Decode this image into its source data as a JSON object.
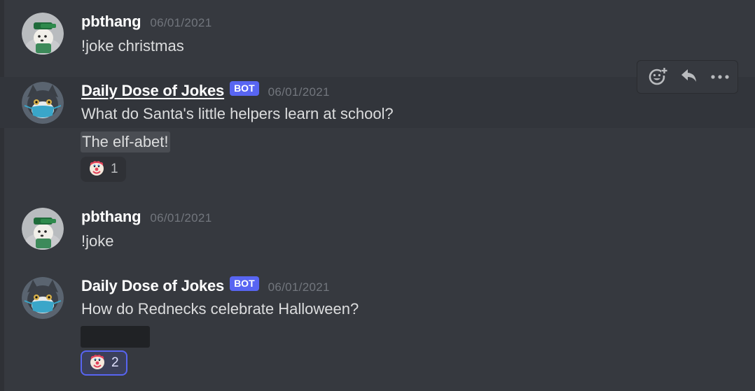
{
  "messages": [
    {
      "author": "pbthang",
      "timestamp": "06/01/2021",
      "content": "!joke christmas",
      "avatar": "dog-avatar"
    },
    {
      "author": "Daily Dose of Jokes",
      "bot_tag": "BOT",
      "timestamp": "06/01/2021",
      "content": "What do Santa's little helpers learn at school?",
      "spoiler": "The elf-abet!",
      "avatar": "cat-avatar",
      "reaction": {
        "emoji": "clown-face",
        "count": "1"
      }
    },
    {
      "author": "pbthang",
      "timestamp": "06/01/2021",
      "content": "!joke",
      "avatar": "dog-avatar"
    },
    {
      "author": "Daily Dose of Jokes",
      "bot_tag": "BOT",
      "timestamp": "06/01/2021",
      "content": "How do Rednecks celebrate Halloween?",
      "spoiler_hidden": true,
      "avatar": "cat-avatar",
      "reaction": {
        "emoji": "clown-face",
        "count": "2",
        "active": true
      }
    }
  ],
  "toolbar": {
    "icons": [
      "add-reaction-icon",
      "reply-icon",
      "more-options-icon"
    ]
  },
  "colors": {
    "background": "#36393f",
    "hover": "#32353b",
    "bot_tag": "#5865f2",
    "timestamp": "#72767d",
    "text": "#dcddde"
  }
}
